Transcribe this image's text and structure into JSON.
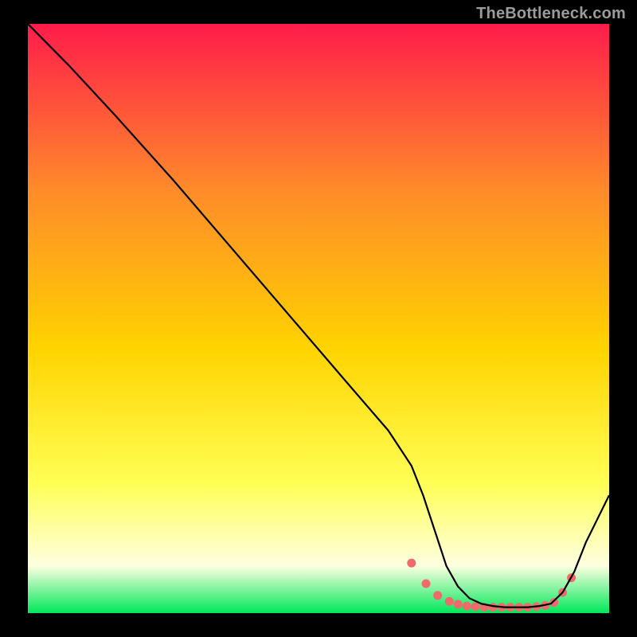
{
  "watermark": "TheBottleneck.com",
  "chart_data": {
    "type": "line",
    "title": "",
    "xlabel": "",
    "ylabel": "",
    "xlim": [
      0,
      100
    ],
    "ylim": [
      0,
      100
    ],
    "gradient_colors": {
      "top": "#ff1c4b",
      "upper_mid": "#ff8a2a",
      "mid": "#ffd300",
      "lower_mid": "#ffff55",
      "near_bottom": "#fdffe0",
      "bottom": "#00e85a"
    },
    "series": [
      {
        "name": "curve",
        "stroke": "#000000",
        "x": [
          0,
          7,
          15,
          25,
          35,
          45,
          55,
          62,
          66,
          68,
          70,
          72,
          74,
          76,
          78,
          80,
          82,
          84,
          86,
          88,
          90,
          92,
          94,
          96,
          100
        ],
        "y": [
          100,
          93,
          84.5,
          73.5,
          62,
          50.5,
          39,
          31,
          25,
          20,
          14,
          8,
          4.5,
          2.5,
          1.6,
          1.2,
          1.0,
          1.0,
          1.0,
          1.2,
          1.6,
          3.5,
          7,
          12,
          20
        ]
      }
    ],
    "markers": {
      "name": "valley-points",
      "fill": "#ef6b6b",
      "x": [
        66,
        68.5,
        70.5,
        72.5,
        74,
        75.5,
        77,
        78.5,
        80,
        81.5,
        83,
        84.5,
        86,
        87.5,
        89,
        90.5,
        92,
        93.5
      ],
      "y": [
        8.5,
        5,
        3,
        2,
        1.5,
        1.2,
        1.1,
        1.0,
        1.0,
        1.0,
        1.0,
        1.0,
        1.0,
        1.1,
        1.3,
        1.8,
        3.5,
        6
      ]
    }
  }
}
